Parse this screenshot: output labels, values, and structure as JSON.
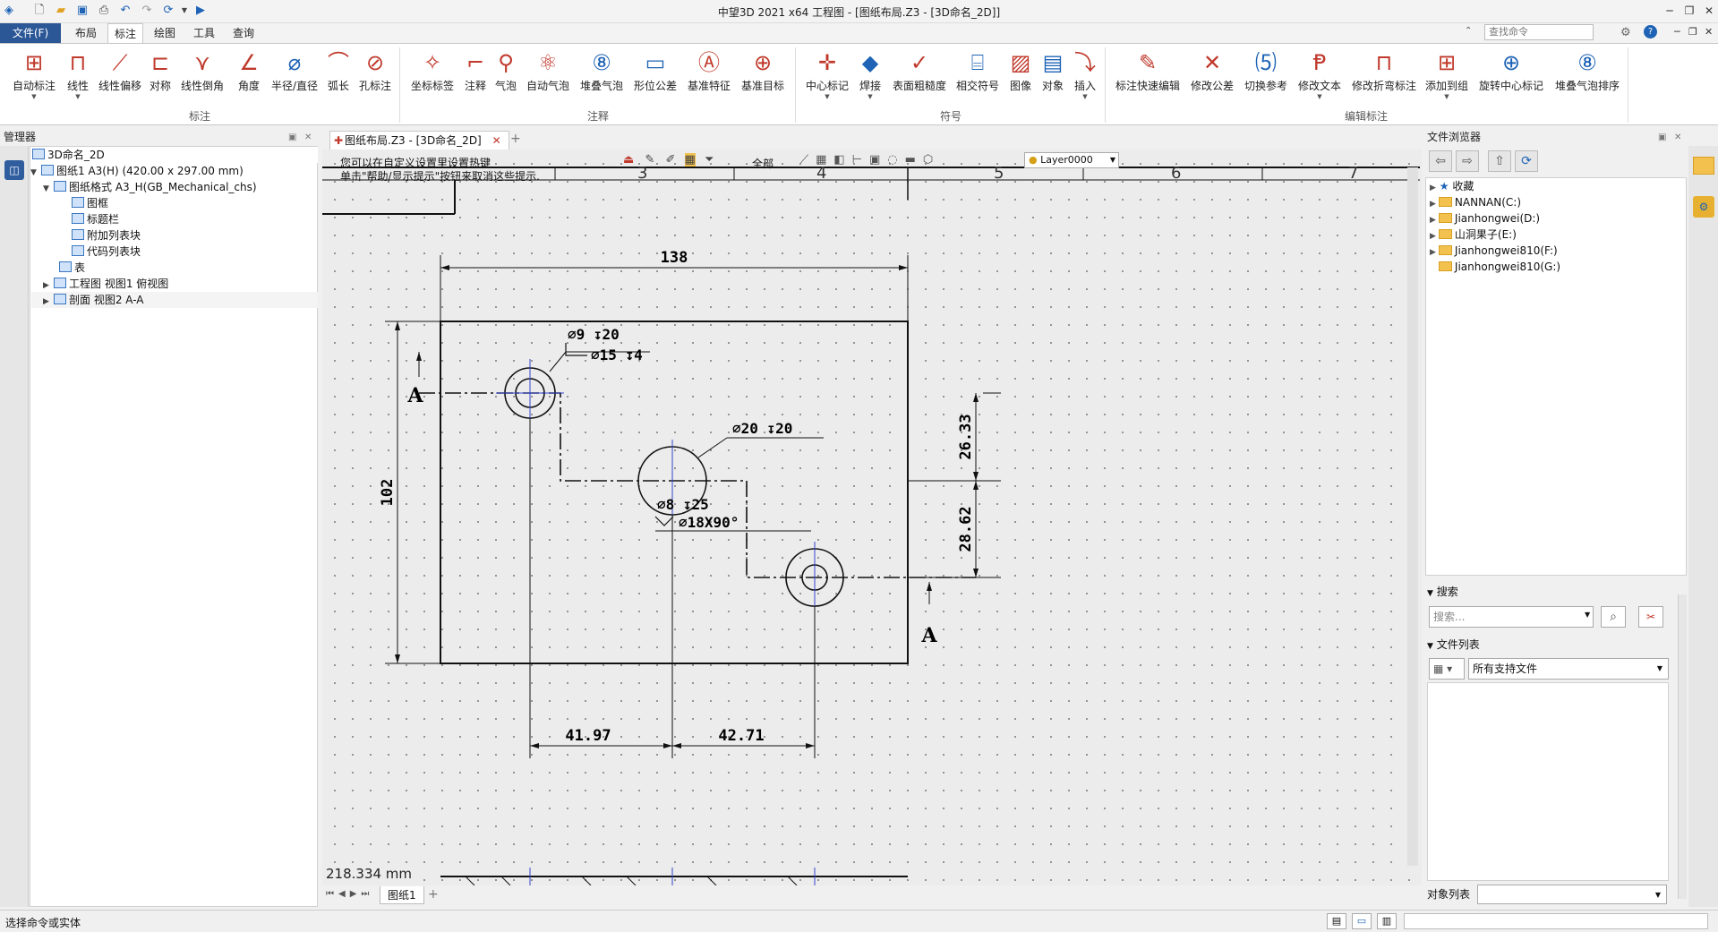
{
  "app": {
    "window_title": "中望3D 2021 x64     工程图 - [图纸布局.Z3 - [3D命名_2D]]",
    "search_placeholder": "查找命令"
  },
  "menu": {
    "file": "文件(F)",
    "tabs": [
      "布局",
      "标注",
      "绘图",
      "工具",
      "查询"
    ],
    "active": "标注"
  },
  "ribbon": {
    "groups": [
      {
        "label": "标注",
        "buttons": [
          "自动标注",
          "线性",
          "线性偏移",
          "对称",
          "线性倒角",
          "角度",
          "半径/直径",
          "弧长",
          "孔标注"
        ]
      },
      {
        "label": "注释",
        "buttons": [
          "坐标标签",
          "注释",
          "气泡",
          "自动气泡",
          "堆叠气泡",
          "形位公差",
          "基准特征",
          "基准目标"
        ]
      },
      {
        "label": "符号",
        "buttons": [
          "中心标记",
          "焊接",
          "表面粗糙度",
          "相交符号",
          "图像",
          "对象",
          "插入"
        ]
      },
      {
        "label": "编辑标注",
        "buttons": [
          "标注快速编辑",
          "修改公差",
          "切换参考",
          "修改文本",
          "修改折弯标注",
          "添加到组",
          "旋转中心标记",
          "堆叠气泡排序"
        ]
      }
    ]
  },
  "manager": {
    "title": "管理器",
    "tree": [
      {
        "label": "3D命名_2D",
        "indent": 0,
        "arrow": ""
      },
      {
        "label": "图纸1 A3(H) (420.00 x 297.00 mm)",
        "indent": 1,
        "arrow": "▼"
      },
      {
        "label": "图纸格式 A3_H(GB_Mechanical_chs)",
        "indent": 2,
        "arrow": "▼"
      },
      {
        "label": "图框",
        "indent": 3,
        "arrow": ""
      },
      {
        "label": "标题栏",
        "indent": 3,
        "arrow": ""
      },
      {
        "label": "附加列表块",
        "indent": 3,
        "arrow": ""
      },
      {
        "label": "代码列表块",
        "indent": 3,
        "arrow": ""
      },
      {
        "label": "表",
        "indent": 2,
        "arrow": ""
      },
      {
        "label": "工程图 视图1 俯视图",
        "indent": 1,
        "arrow": "▶"
      },
      {
        "label": "剖面 视图2 A-A",
        "indent": 1,
        "arrow": "▶"
      }
    ]
  },
  "doc": {
    "tab": "图纸布局.Z3 - [3D命名_2D]",
    "hint1": "您可以在自定义设置里设置热键",
    "hint2": "单击\"帮助/显示提示\"按钮来取消这些提示.",
    "filter": "全部",
    "layer": "Layer0000",
    "ruler": [
      "3",
      "4",
      "5",
      "6",
      "7"
    ],
    "readout": "218.334 mm",
    "sheet_tab": "图纸1"
  },
  "drawing": {
    "dim_top": "138",
    "dim_left": "102",
    "dim_right1": "26.33",
    "dim_right2": "28.62",
    "dim_bottom1": "41.97",
    "dim_bottom2": "42.71",
    "hole1_a": "⌀9 ↧20",
    "hole1_b": "⌀15 ↧4",
    "hole2": "⌀20 ↧20",
    "hole3_a": "⌀8 ↧25",
    "hole3_b": "⌀18X90°",
    "section_a": "A",
    "section_b": "A"
  },
  "browser": {
    "title": "文件浏览器",
    "items": [
      "收藏",
      "NANNAN(C:)",
      "Jianhongwei(D:)",
      "山洞果子(E:)",
      "Jianhongwei810(F:)",
      "Jianhongwei810(G:)"
    ],
    "search_title": "搜索",
    "search_placeholder": "搜索...",
    "filelist_title": "文件列表",
    "filter": "所有支持文件",
    "object_list": "对象列表"
  },
  "status": {
    "text": "选择命令或实体"
  }
}
